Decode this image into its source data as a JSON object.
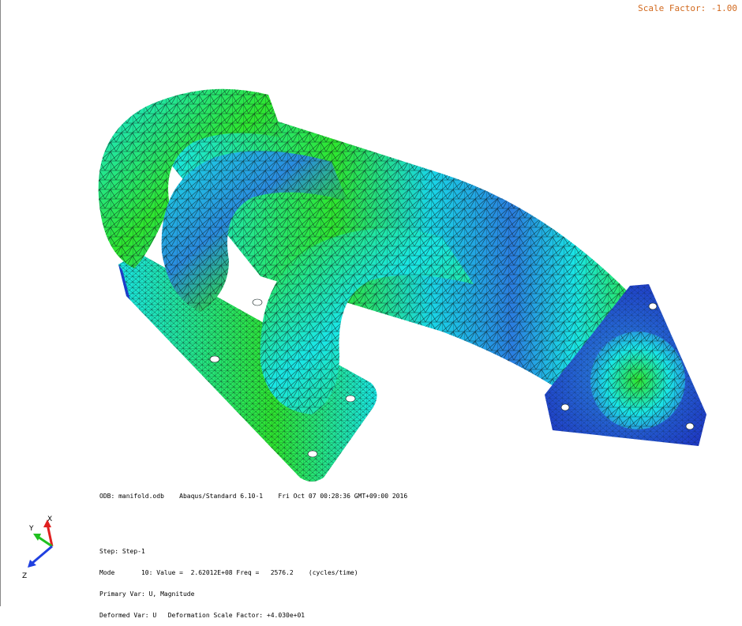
{
  "header": {
    "scale_factor": "Scale Factor: -1.00"
  },
  "legend": {
    "odb": "ODB: manifold.odb    Abaqus/Standard 6.10-1    Fri Oct 07 00:28:36 GMT+09:00 2016",
    "step": "Step: Step-1",
    "mode": "Mode       10: Value =  2.62012E+08 Freq =   2576.2    (cycles/time)",
    "primary_var": "Primary Var: U, Magnitude",
    "deformed_var": "Deformed Var: U   Deformation Scale Factor: +4.030e+01"
  },
  "triad": {
    "x_label": "X",
    "y_label": "Y",
    "z_label": "Z",
    "x_color": "#e02020",
    "y_color": "#20c020",
    "z_color": "#2040e0"
  },
  "colors": {
    "cyan": "#19e6e6",
    "green": "#2ee62e",
    "light_green": "#4dd94d",
    "blue": "#2a7de0",
    "dark_blue": "#1f3cc8",
    "mesh": "#0a1a1a"
  }
}
